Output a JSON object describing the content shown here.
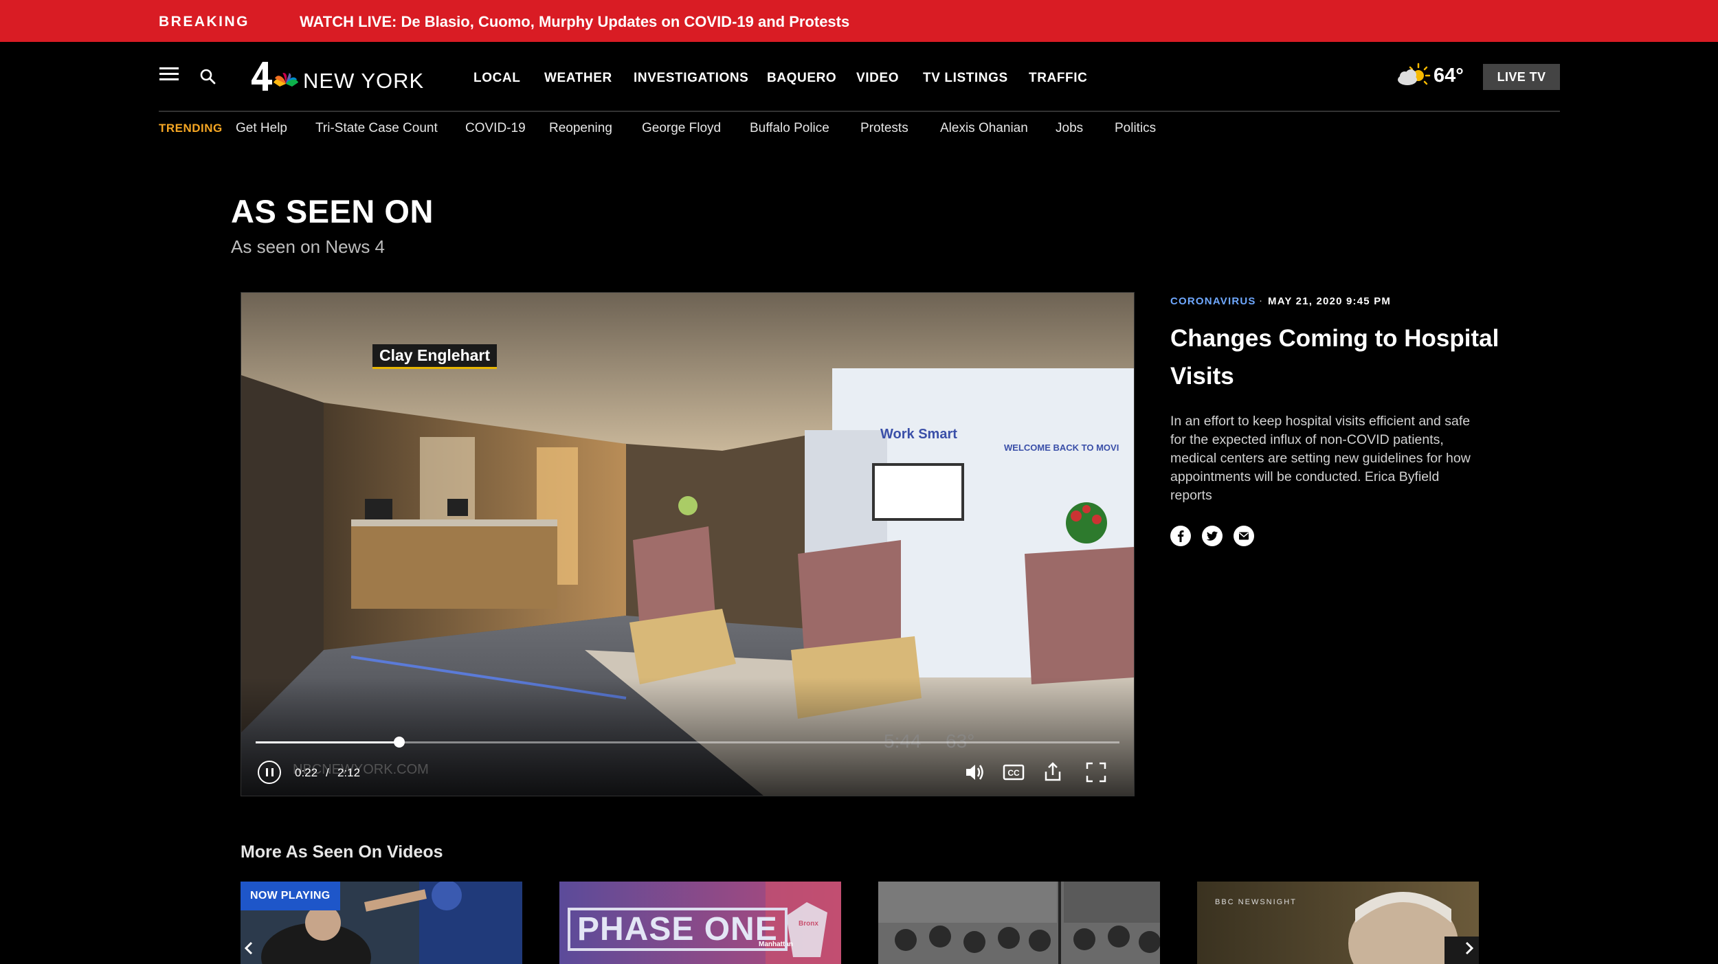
{
  "breaking": {
    "label": "BREAKING",
    "headline": "WATCH LIVE: De Blasio, Cuomo, Murphy Updates on COVID-19 and Protests"
  },
  "header": {
    "logo_text": "NEW YORK",
    "nav": [
      "LOCAL",
      "WEATHER",
      "INVESTIGATIONS",
      "BAQUERO",
      "VIDEO",
      "TV LISTINGS",
      "TRAFFIC"
    ],
    "weather_temp": "64°",
    "weather_icon": "partly-sunny-icon",
    "live_tv": "LIVE TV"
  },
  "trending": {
    "label": "TRENDING",
    "items": [
      "Get Help",
      "Tri-State Case Count",
      "COVID-19",
      "Reopening",
      "George Floyd",
      "Buffalo Police",
      "Protests",
      "Alexis Ohanian",
      "Jobs",
      "Politics"
    ]
  },
  "section": {
    "title": "AS SEEN ON",
    "subtitle": "As seen on News 4"
  },
  "video": {
    "lower_third": "Clay Englehart",
    "scene_sign_1": "Work Smart",
    "scene_sign_2": "WELCOME BACK TO MOVI",
    "overlay_time": "5:44",
    "overlay_temp": "63°",
    "overlay_site": "NBCNEWYORK.COM",
    "current_time": "0:22",
    "separator": "/",
    "duration": "2:12",
    "progress": 0.166
  },
  "article": {
    "category": "CORONAVIRUS",
    "dot": "·",
    "date": "MAY 21, 2020 9:45 PM",
    "title": "Changes Coming to Hospital Visits",
    "description": "In an effort to keep hospital visits efficient and safe for the expected influx of non-COVID patients, medical centers are setting new guidelines for how appointments will be conducted. Erica Byfield reports",
    "share_icons": [
      "facebook-icon",
      "twitter-icon",
      "email-icon"
    ]
  },
  "more": {
    "title": "More As Seen On Videos",
    "now_playing": "NOW PLAYING",
    "thumb2_text": "PHASE ONE",
    "thumb2_label_1": "Bronx",
    "thumb2_label_2": "Manhattan",
    "thumb4_text": "BBC NEWSNIGHT"
  },
  "colors": {
    "breaking_bar": "#d91c24",
    "trending_label": "#f5a623",
    "category": "#6fa8ff",
    "now_playing": "#1e56c9"
  }
}
